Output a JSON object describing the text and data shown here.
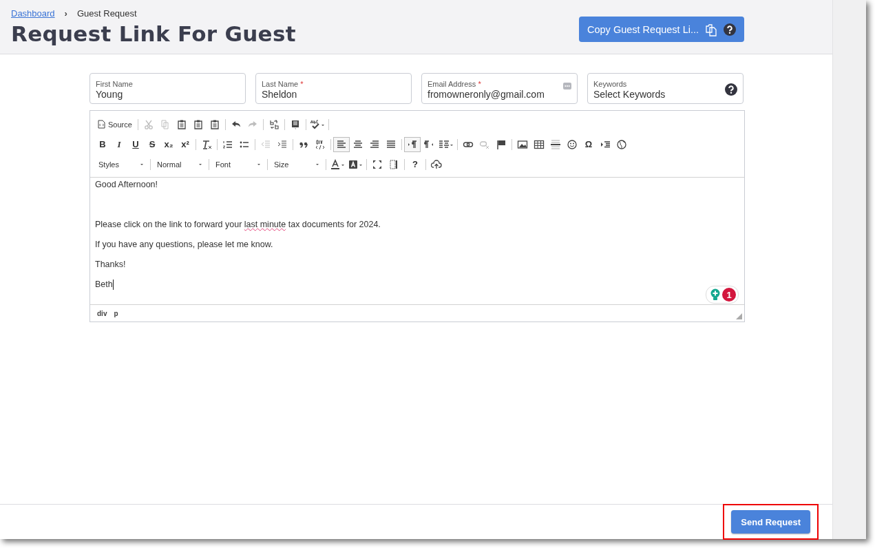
{
  "breadcrumb": {
    "link": "Dashboard",
    "separator": "›",
    "current": "Guest Request"
  },
  "title": "Request Link For Guest",
  "copy_button": {
    "label": "Copy Guest Request Li..."
  },
  "fields": [
    {
      "label": "First Name",
      "required": false,
      "value": "Young",
      "kind": "text"
    },
    {
      "label": "Last Name",
      "required": true,
      "value": "Sheldon",
      "kind": "text"
    },
    {
      "label": "Email Address",
      "required": true,
      "value": "fromowneronly@gmail.com",
      "kind": "email"
    },
    {
      "label": "Keywords",
      "required": false,
      "placeholder": "Select Keywords",
      "kind": "select"
    }
  ],
  "required_mark": "*",
  "toolbar": [
    [
      {
        "kind": "source",
        "label": "Source"
      },
      {
        "kind": "sep"
      },
      {
        "kind": "cut",
        "disabled": true
      },
      {
        "kind": "copy",
        "disabled": true
      },
      {
        "kind": "paste",
        "disabled": false
      },
      {
        "kind": "paste",
        "disabled": false
      },
      {
        "kind": "paste",
        "disabled": false
      },
      {
        "kind": "sep"
      },
      {
        "kind": "undo",
        "disabled": false
      },
      {
        "kind": "redo",
        "disabled": true
      },
      {
        "kind": "sep"
      },
      {
        "kind": "replace",
        "disabled": false
      },
      {
        "kind": "sep"
      },
      {
        "kind": "template",
        "disabled": false
      },
      {
        "kind": "sep"
      },
      {
        "kind": "spellcheck",
        "disabled": false
      },
      {
        "kind": "sep"
      }
    ],
    [
      {
        "kind": "bold",
        "text": "B"
      },
      {
        "kind": "italic",
        "text": "I"
      },
      {
        "kind": "underline",
        "text": "U"
      },
      {
        "kind": "strike",
        "text": "S"
      },
      {
        "kind": "subscript",
        "text": "x₂"
      },
      {
        "kind": "superscript",
        "text": "x²"
      },
      {
        "kind": "sep"
      },
      {
        "kind": "clearformat",
        "disabled": false
      },
      {
        "kind": "sep"
      },
      {
        "kind": "numlist",
        "disabled": false
      },
      {
        "kind": "bulletlist",
        "disabled": false
      },
      {
        "kind": "sep"
      },
      {
        "kind": "outdent",
        "disabled": true
      },
      {
        "kind": "indent",
        "disabled": false
      },
      {
        "kind": "sep"
      },
      {
        "kind": "quote",
        "disabled": false
      },
      {
        "kind": "div",
        "disabled": false
      },
      {
        "kind": "sep"
      },
      {
        "kind": "alignleft",
        "selected": true
      },
      {
        "kind": "aligncenter",
        "selected": false
      },
      {
        "kind": "alignright",
        "selected": false
      },
      {
        "kind": "justify",
        "selected": false
      },
      {
        "kind": "sep"
      },
      {
        "kind": "ltr",
        "selected": true
      },
      {
        "kind": "rtl",
        "selected": false
      },
      {
        "kind": "language",
        "disabled": false
      },
      {
        "kind": "sep"
      },
      {
        "kind": "link",
        "disabled": false
      },
      {
        "kind": "unlink",
        "disabled": true
      },
      {
        "kind": "flag",
        "disabled": false
      },
      {
        "kind": "sep"
      },
      {
        "kind": "image",
        "disabled": false
      },
      {
        "kind": "table",
        "disabled": false
      },
      {
        "kind": "hrule",
        "disabled": false
      },
      {
        "kind": "smiley",
        "disabled": false
      },
      {
        "kind": "symbol",
        "text": "Ω"
      },
      {
        "kind": "pagebreak",
        "disabled": false
      },
      {
        "kind": "globe",
        "disabled": false
      }
    ],
    [
      {
        "kind": "combo",
        "label": "Styles"
      },
      {
        "kind": "sep"
      },
      {
        "kind": "combo",
        "label": "Normal"
      },
      {
        "kind": "sep"
      },
      {
        "kind": "combo",
        "label": "Font"
      },
      {
        "kind": "sep"
      },
      {
        "kind": "combo",
        "label": "Size"
      },
      {
        "kind": "sep"
      },
      {
        "kind": "textcolor",
        "disabled": false
      },
      {
        "kind": "bgcolor",
        "disabled": false
      },
      {
        "kind": "sep"
      },
      {
        "kind": "maximize",
        "disabled": false
      },
      {
        "kind": "blocks",
        "disabled": false
      },
      {
        "kind": "sep"
      },
      {
        "kind": "help",
        "text": "?"
      },
      {
        "kind": "sep"
      },
      {
        "kind": "upload",
        "disabled": false
      }
    ]
  ],
  "body": [
    {
      "runs": [
        {
          "text": "Good Afternoon!",
          "flagged": false
        }
      ],
      "gap_after": true
    },
    {
      "runs": [
        {
          "text": "Please click on the link to forward your ",
          "flagged": false
        },
        {
          "text": "last minute",
          "flagged": true
        },
        {
          "text": " tax documents for 2024.",
          "flagged": false
        }
      ],
      "gap_after": false
    },
    {
      "runs": [
        {
          "text": "If you have any questions, please let me know.",
          "flagged": false
        }
      ],
      "gap_after": false
    },
    {
      "runs": [
        {
          "text": "Thanks!",
          "flagged": false
        }
      ],
      "gap_after": false
    },
    {
      "runs": [
        {
          "text": "Beth",
          "flagged": false
        }
      ],
      "gap_after": false
    }
  ],
  "assistant_badge": {
    "count": "1"
  },
  "element_path": [
    "div",
    "p"
  ],
  "send_button": {
    "label": "Send Request",
    "highlighted": true
  }
}
